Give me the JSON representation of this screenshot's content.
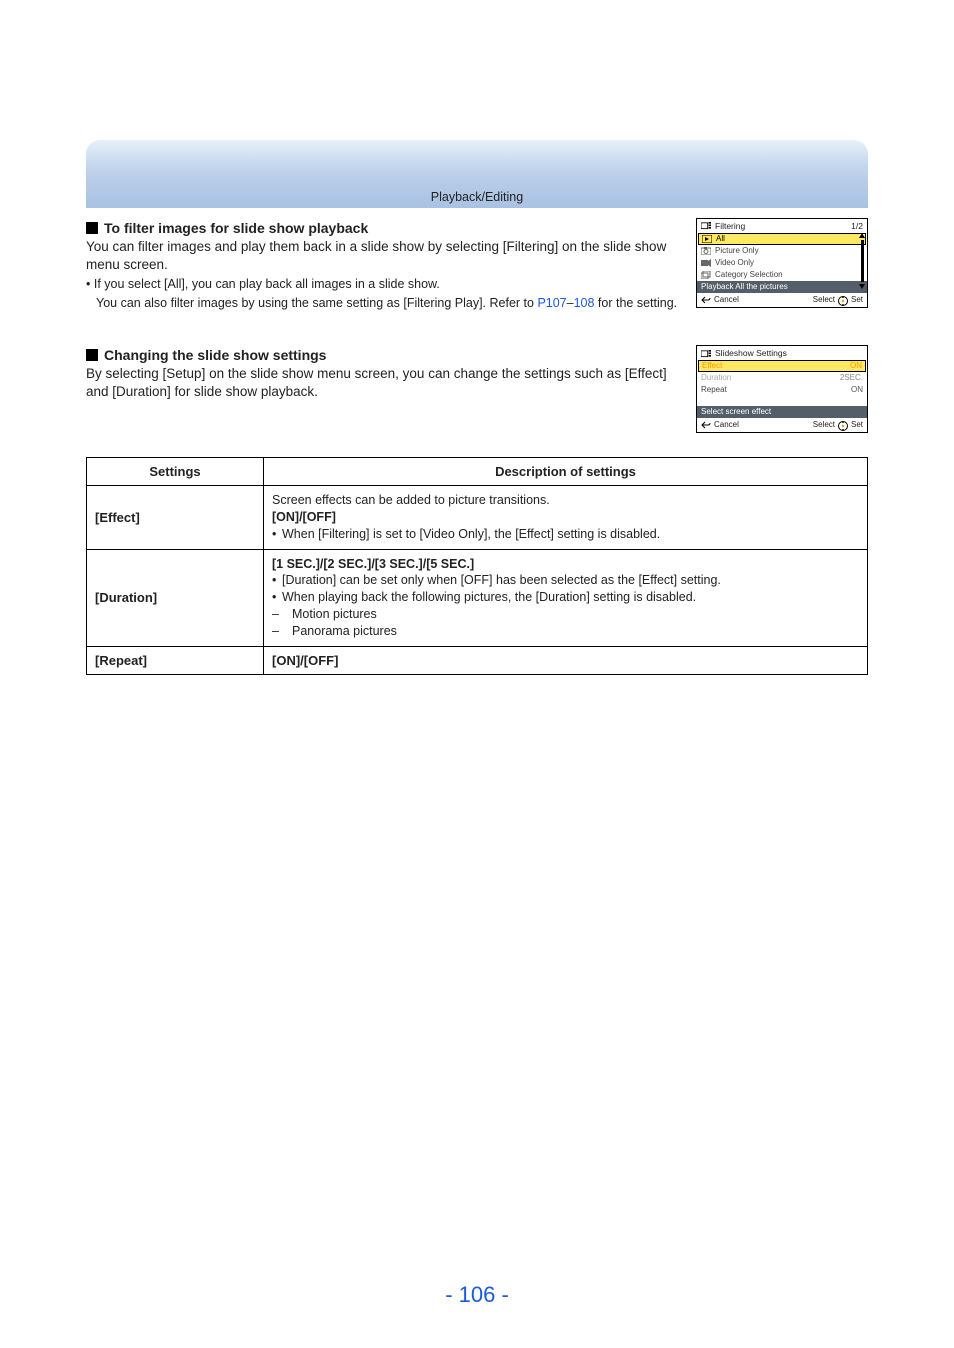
{
  "header": {
    "title": "Playback/Editing"
  },
  "section_filter": {
    "heading": "To filter images for slide show playback",
    "para": "You can filter images and play them back in a slide show by selecting [Filtering] on the slide show menu screen.",
    "b1": "If you select [All], you can play back all images in a slide show.",
    "b2": "You can also filter images by using the same setting as [Filtering Play]. Refer to ",
    "link1": "P107",
    "dash": "–",
    "link2": "108",
    "b2_tail": " for the setting."
  },
  "section_change": {
    "heading": "Changing the slide show settings",
    "para": "By selecting [Setup] on the slide show menu screen, you can change the settings such as [Effect] and [Duration] for slide show playback."
  },
  "mini_filter": {
    "title": "Filtering",
    "page": "1/2",
    "items": [
      "All",
      "Picture Only",
      "Video Only",
      "Category Selection"
    ],
    "hint": "Playback All the pictures",
    "foot_left": "Cancel",
    "foot_right_a": "Select",
    "foot_right_b": "Set"
  },
  "mini_settings": {
    "title": "Slideshow Settings",
    "rows": [
      {
        "label": "Effect",
        "value": "ON"
      },
      {
        "label": "Duration",
        "value": "2SEC."
      },
      {
        "label": "Repeat",
        "value": "ON"
      }
    ],
    "hint": "Select screen effect",
    "foot_left": "Cancel",
    "foot_right_a": "Select",
    "foot_right_b": "Set"
  },
  "table": {
    "h1": "Settings",
    "h2": "Description of settings",
    "rows": {
      "effect": {
        "name": "[Effect]",
        "l1": "Screen effects can be added to picture transitions.",
        "l2": "[ON]/[OFF]",
        "l3": "When [Filtering] is set to [Video Only], the [Effect] setting is disabled."
      },
      "duration": {
        "name": "[Duration]",
        "l1": "[1 SEC.]/[2 SEC.]/[3 SEC.]/[5 SEC.]",
        "l2": "[Duration] can be set only when [OFF] has been selected as the [Effect] setting.",
        "l3": "When playing back the following pictures, the [Duration] setting is disabled.",
        "l4": "Motion pictures",
        "l5": "Panorama pictures"
      },
      "repeat": {
        "name": "[Repeat]",
        "l1": "[ON]/[OFF]"
      }
    }
  },
  "page_number": "- 106 -"
}
